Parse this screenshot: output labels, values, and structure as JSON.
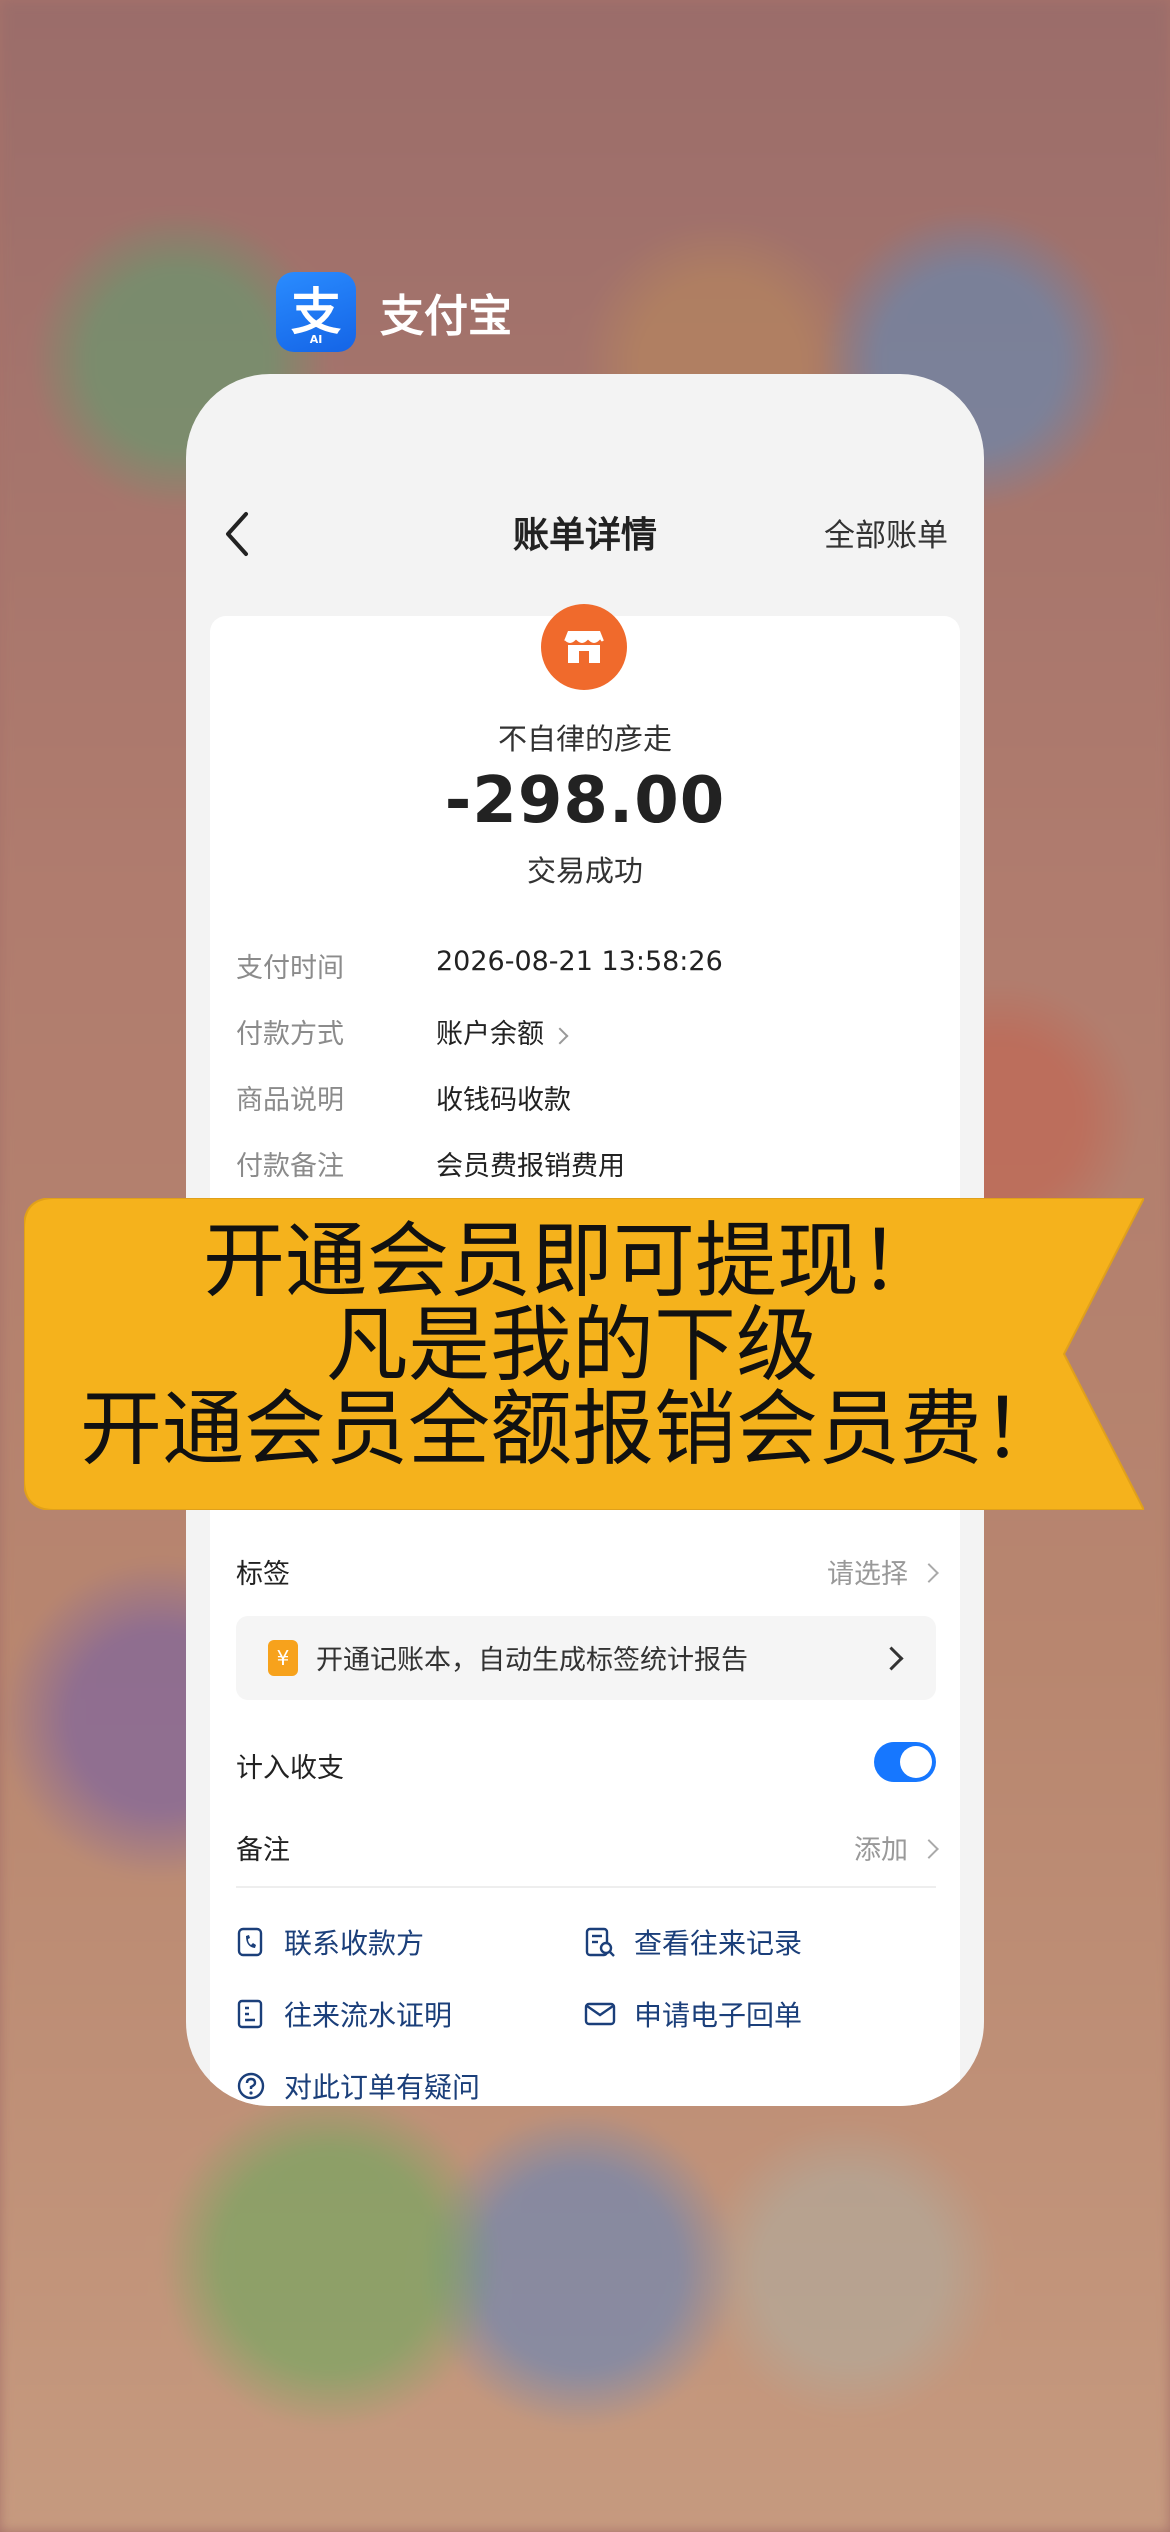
{
  "app": {
    "name": "支付宝",
    "icon": "alipay-icon",
    "icon_badge": "AI"
  },
  "nav": {
    "title": "账单详情",
    "right_link": "全部账单"
  },
  "bill": {
    "merchant": "不自律的彦走",
    "amount": "-298.00",
    "status": "交易成功",
    "details": [
      {
        "label": "支付时间",
        "value": "2026-08-21 13:58:26"
      },
      {
        "label": "付款方式",
        "value": "账户余额"
      },
      {
        "label": "商品说明",
        "value": "收钱码收款"
      },
      {
        "label": "付款备注",
        "value": "会员费报销费用"
      }
    ]
  },
  "options": {
    "tag_label": "标签",
    "tag_value": "请选择",
    "promo_text": "开通记账本，自动生成标签统计报告",
    "promo_icon": "¥",
    "count_label": "计入收支",
    "count_toggle_on": true,
    "note_label": "备注",
    "note_value": "添加"
  },
  "actions": [
    {
      "label": "联系收款方",
      "icon": "phone-icon"
    },
    {
      "label": "查看往来记录",
      "icon": "records-icon"
    },
    {
      "label": "往来流水证明",
      "icon": "statement-icon"
    },
    {
      "label": "申请电子回单",
      "icon": "envelope-icon"
    },
    {
      "label": "对此订单有疑问",
      "icon": "question-icon"
    }
  ],
  "banner": {
    "line1": "开通会员即可提现！",
    "line2": "凡是我的下级",
    "line3": "开通会员全额报销会员费！"
  },
  "colors": {
    "accent": "#1677ff",
    "merchant": "#f06a2c",
    "banner": "#f5b21c",
    "action_text": "#1b3f7a"
  }
}
